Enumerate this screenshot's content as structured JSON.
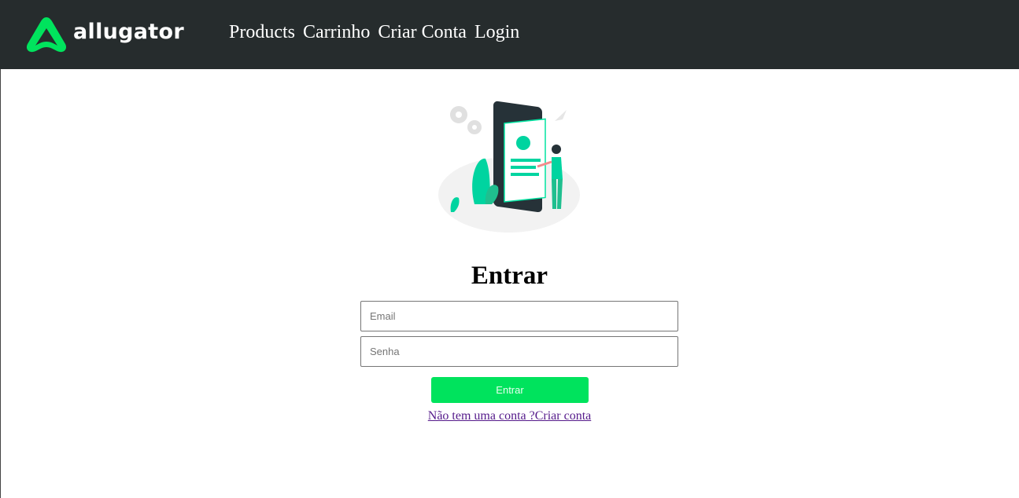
{
  "navbar": {
    "brand": "allugator",
    "links": [
      "Products",
      "Carrinho",
      "Criar Conta",
      "Login"
    ]
  },
  "login": {
    "title": "Entrar",
    "email_placeholder": "Email",
    "password_placeholder": "Senha",
    "submit_label": "Entrar",
    "signup_text": "Não tem uma conta ?Criar conta"
  },
  "colors": {
    "navbar_bg": "#262c2d",
    "accent": "#00e35d",
    "link_visited": "#551a8b"
  }
}
